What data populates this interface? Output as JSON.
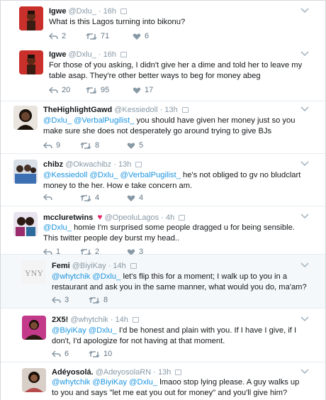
{
  "tweets": [
    {
      "name": "Igwe",
      "handle": "@Dxlu_",
      "time": "16h",
      "segments": [
        {
          "t": "What is this Lagos turning into bikonu?"
        }
      ],
      "replies": "2",
      "retweets": "71",
      "likes": "6"
    },
    {
      "name": "Igwe",
      "handle": "@Dxlu_",
      "time": "16h",
      "segments": [
        {
          "t": "For those of you asking, I didn't give her a dime and told her to leave my table asap. They're other better ways to beg for money abeg"
        }
      ],
      "replies": "20",
      "retweets": "95",
      "likes": "17"
    },
    {
      "name": "TheHighlightGawd",
      "handle": "@Kessiedoll",
      "time": "13h",
      "segments": [
        {
          "t": "@Dxlu_",
          "m": true
        },
        {
          "t": " "
        },
        {
          "t": "@VerbalPugilist_",
          "m": true
        },
        {
          "t": " you should have given her money just so you make sure she does not desperately go around trying to give BJs"
        }
      ],
      "replies": "9",
      "retweets": "8",
      "likes": "5"
    },
    {
      "name": "chibz",
      "handle": "@Okwachibz",
      "time": "13h",
      "segments": [
        {
          "t": "@Kessiedoll",
          "m": true
        },
        {
          "t": " "
        },
        {
          "t": "@Dxlu_",
          "m": true
        },
        {
          "t": " "
        },
        {
          "t": "@VerbalPugilist_",
          "m": true
        },
        {
          "t": " he's not obliged to gv no bludclart money to the her. How e take concern am."
        }
      ],
      "replies": "",
      "retweets": "4",
      "likes": "4"
    },
    {
      "name": "mccluretwins",
      "handle": "@OpeoluLagos",
      "time": "4h",
      "segments": [
        {
          "t": "@Dxlu_",
          "m": true
        },
        {
          "t": " homie I'm surprised some people dragged u for being sensible. This twitter people dey burst my head.."
        }
      ],
      "replies": "1",
      "retweets": "2",
      "likes": "3"
    },
    {
      "name": "Femi",
      "handle": "@BiyiKay",
      "time": "14h",
      "segments": [
        {
          "t": "@whytchik",
          "m": true
        },
        {
          "t": " "
        },
        {
          "t": "@Dxlu_",
          "m": true
        },
        {
          "t": " let's flip this for a moment; I walk up to you in a restaurant and ask you in the same manner, what would you do, ma'am?"
        }
      ],
      "replies": "3",
      "retweets": "8",
      "likes": ""
    },
    {
      "name": "2X5!",
      "handle": "@whytchik",
      "time": "14h",
      "segments": [
        {
          "t": "@BiyiKay",
          "m": true
        },
        {
          "t": " "
        },
        {
          "t": "@Dxlu_",
          "m": true
        },
        {
          "t": " I'd be honest and plain with you. If I have I give, if I don't, I'd apologize for not having at that moment."
        }
      ],
      "replies": "6",
      "retweets": "10",
      "likes": ""
    },
    {
      "name": "Adéyosolá.",
      "handle": "@AdeyosolaRN",
      "time": "13h",
      "segments": [
        {
          "t": "@whytchik",
          "m": true
        },
        {
          "t": " "
        },
        {
          "t": "@BiyiKay",
          "m": true
        },
        {
          "t": " "
        },
        {
          "t": "@Dxlu_",
          "m": true
        },
        {
          "t": " lmaoo stop lying please. A guy walks up to you and says \"let me eat you out for money\" and you'll give him?"
        }
      ],
      "replies": "",
      "retweets": "",
      "likes": ""
    }
  ],
  "icons": {
    "reply": "reply-icon",
    "retweet": "retweet-icon",
    "like": "heart-icon",
    "more": "chevron-down-icon",
    "verified_media": "media-badge-icon"
  },
  "colors": {
    "mention": "#1b95e0",
    "meta": "#8899a6",
    "action": "#657786",
    "heart_emoji": "#e0245e",
    "highlight_bg": "#f5f8fa"
  }
}
